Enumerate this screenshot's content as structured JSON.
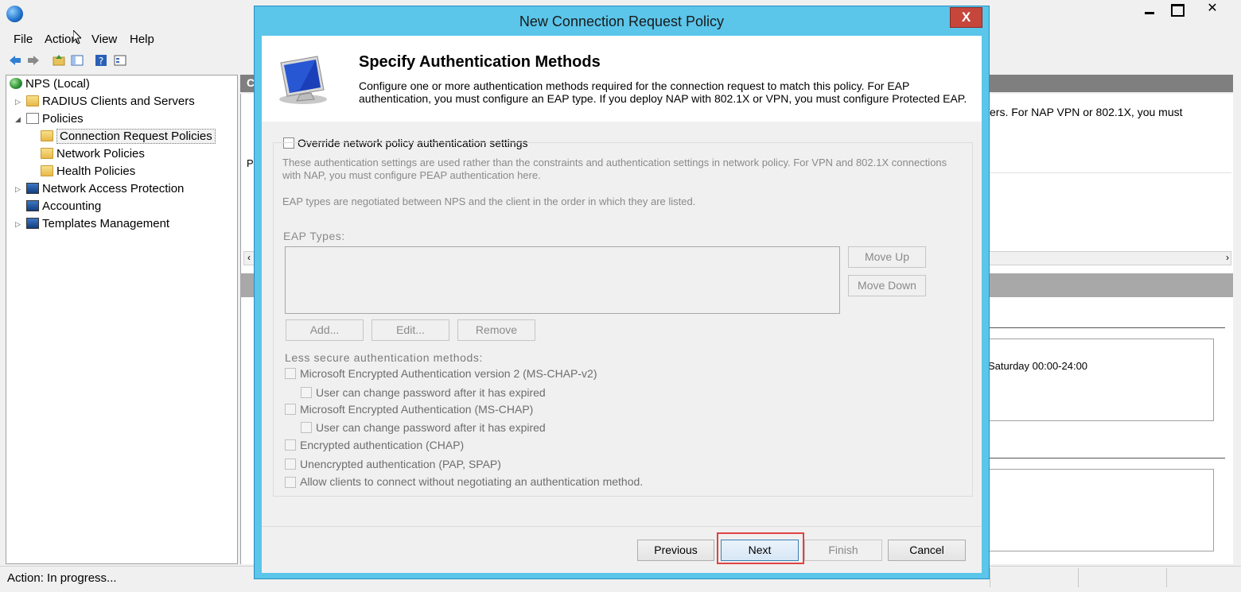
{
  "mmc": {
    "menu": [
      "File",
      "Action",
      "View",
      "Help"
    ],
    "tree": {
      "root": "NPS (Local)",
      "items": [
        {
          "label": "RADIUS Clients and Servers"
        },
        {
          "label": "Policies"
        },
        {
          "label": "Connection Request Policies"
        },
        {
          "label": "Network Policies"
        },
        {
          "label": "Health Policies"
        },
        {
          "label": "Network Access Protection"
        },
        {
          "label": "Accounting"
        },
        {
          "label": "Templates Management"
        }
      ]
    },
    "right_pane": {
      "header_fragment": "C",
      "list_fragment": "P",
      "text_fragment": "ers. For NAP VPN or 802.1X, you must",
      "schedule_fragment": "Saturday 00:00-24:00"
    },
    "status": "Action:  In progress..."
  },
  "dialog": {
    "title": "New Connection Request Policy",
    "close_label": "X",
    "header": {
      "title": "Specify Authentication Methods",
      "description": "Configure one or more authentication methods required for the connection request to match this policy. For EAP authentication, you must configure an EAP type. If you deploy NAP with 802.1X or VPN, you must configure Protected EAP."
    },
    "override_label": "Override network policy authentication settings",
    "override_checked": false,
    "info_text": "These authentication settings are used rather than the constraints and authentication settings in network policy. For VPN and 802.1X connections with NAP, you must configure PEAP authentication here.",
    "eap_order_text": "EAP types are negotiated between NPS and the client in the order in which they are listed.",
    "eap_types_label": "EAP Types:",
    "buttons": {
      "move_up": "Move Up",
      "move_down": "Move Down",
      "add": "Add...",
      "edit": "Edit...",
      "remove": "Remove"
    },
    "less_secure_label": "Less secure authentication methods:",
    "methods": [
      {
        "label": "Microsoft Encrypted Authentication version 2 (MS-CHAP-v2)"
      },
      {
        "label": "User can change password after it has expired"
      },
      {
        "label": "Microsoft Encrypted Authentication (MS-CHAP)"
      },
      {
        "label": "User can change password after it has expired"
      },
      {
        "label": "Encrypted authentication (CHAP)"
      },
      {
        "label": "Unencrypted authentication (PAP, SPAP)"
      },
      {
        "label": "Allow clients to connect without negotiating an authentication method."
      }
    ],
    "footer": {
      "previous": "Previous",
      "next": "Next",
      "finish": "Finish",
      "cancel": "Cancel"
    },
    "colors": {
      "title_bar": "#5bc5ea",
      "close_button": "#c7463b",
      "highlight": "#e04343"
    }
  }
}
